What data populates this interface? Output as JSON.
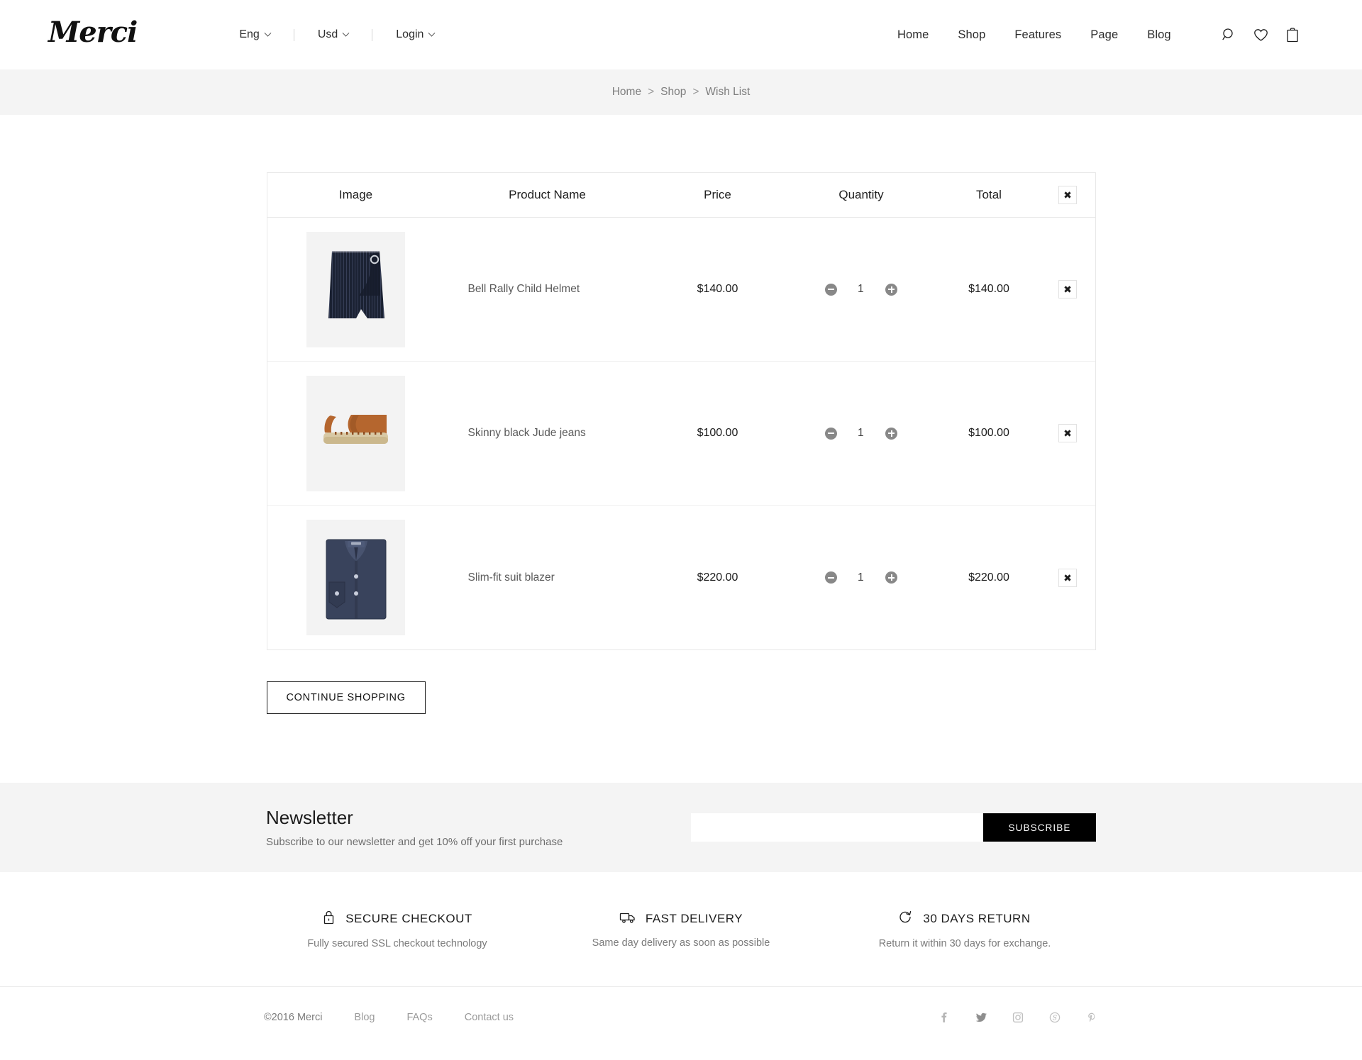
{
  "header": {
    "logo": "Merci",
    "utility": [
      {
        "label": "Eng",
        "name": "language-selector"
      },
      {
        "label": "Usd",
        "name": "currency-selector"
      },
      {
        "label": "Login",
        "name": "login-menu"
      }
    ],
    "nav": [
      {
        "label": "Home"
      },
      {
        "label": "Shop"
      },
      {
        "label": "Features"
      },
      {
        "label": "Page"
      },
      {
        "label": "Blog"
      }
    ],
    "icons": [
      {
        "name": "search-icon"
      },
      {
        "name": "heart-icon"
      },
      {
        "name": "bag-icon"
      }
    ]
  },
  "breadcrumb": {
    "home": "Home",
    "sep1": ">",
    "shop": "Shop",
    "sep2": ">",
    "current": "Wish List"
  },
  "table": {
    "headers": {
      "image": "Image",
      "product_name": "Product Name",
      "price": "Price",
      "quantity": "Quantity",
      "total": "Total",
      "remove": "✖"
    },
    "rows": [
      {
        "image_alt": "navy-pinstripe-wrap-skirt",
        "name": "Bell Rally Child Helmet",
        "price": "$140.00",
        "quantity": "1",
        "total": "$140.00",
        "remove": "✖"
      },
      {
        "image_alt": "tan-espadrille-sandal",
        "name": "Skinny black Jude jeans",
        "price": "$100.00",
        "quantity": "1",
        "total": "$100.00",
        "remove": "✖"
      },
      {
        "image_alt": "navy-folded-dress-shirt",
        "name": "Slim-fit suit blazer",
        "price": "$220.00",
        "quantity": "1",
        "total": "$220.00",
        "remove": "✖"
      }
    ]
  },
  "actions": {
    "continue_shopping": "CONTINUE SHOPPING"
  },
  "newsletter": {
    "title": "Newsletter",
    "subtitle": "Subscribe to our newsletter and get 10% off your first purchase",
    "input_value": "",
    "input_placeholder": "",
    "button": "SUBSCRIBE"
  },
  "features": [
    {
      "icon": "lock-icon",
      "title": "SECURE CHECKOUT",
      "desc": "Fully secured SSL checkout technology"
    },
    {
      "icon": "truck-icon",
      "title": "FAST DELIVERY",
      "desc": "Same day delivery as soon as possible"
    },
    {
      "icon": "return-arrow-icon",
      "title": "30 DAYS RETURN",
      "desc": "Return it within 30 days for exchange."
    }
  ],
  "footer": {
    "copyright": "©2016 Merci",
    "links": [
      {
        "label": "Blog"
      },
      {
        "label": "FAQs"
      },
      {
        "label": "Contact us"
      }
    ],
    "social": [
      {
        "name": "facebook-icon"
      },
      {
        "name": "twitter-icon"
      },
      {
        "name": "instagram-icon"
      },
      {
        "name": "skype-icon"
      },
      {
        "name": "pinterest-icon"
      }
    ]
  },
  "colors": {
    "accent": "#000000",
    "muted": "#7b7b7b",
    "band": "#f4f4f4"
  }
}
